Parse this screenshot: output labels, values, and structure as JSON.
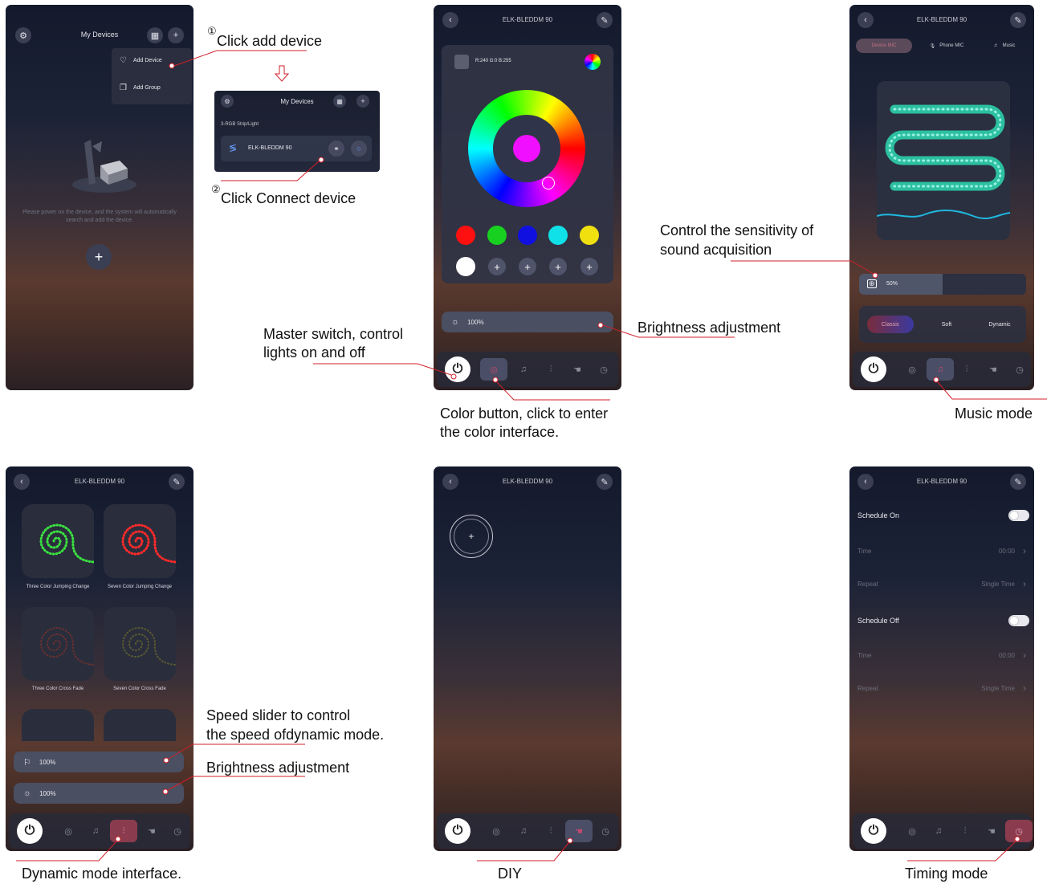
{
  "screen1": {
    "title": "My Devices",
    "menu": {
      "add_device": "Add Device",
      "add_group": "Add Group"
    },
    "hint": "Please power on the device, and the system will automatically search and add the device."
  },
  "popup": {
    "title": "My Devices",
    "section": "3-RGB Strip/Light",
    "device_name": "ELK-BLEDDM 90"
  },
  "screen2": {
    "title": "ELK-BLEDDM 90",
    "rgb_readout": "R:240 G:0 B:255",
    "brightness": "100%",
    "swatches": [
      "#ff1010",
      "#18d020",
      "#1010e0",
      "#10e0e8",
      "#f0e010",
      "#ffffff"
    ],
    "selected_color": "#f010ff"
  },
  "screen3": {
    "title": "ELK-BLEDDM 90",
    "tabs": [
      "Device MIC",
      "Phone MIC",
      "Music"
    ],
    "sensitivity": "50%",
    "sensitivity_fraction": 0.5,
    "modes": [
      "Classic",
      "Soft",
      "Dynamic"
    ]
  },
  "screen4": {
    "title": "ELK-BLEDDM 90",
    "tiles": [
      "Three Color Jumping Change",
      "Seven Color Jumping Change",
      "Three Color Cross Fade",
      "Seven Color Cross Fade"
    ],
    "speed": "100%",
    "brightness": "100%"
  },
  "screen5": {
    "title": "ELK-BLEDDM 90"
  },
  "screen6": {
    "title": "ELK-BLEDDM 90",
    "schedule_on": "Schedule On",
    "schedule_off": "Schedule Off",
    "time_label": "Time",
    "time_value": "00:00",
    "repeat_label": "Repeat",
    "repeat_value": "Single Time"
  },
  "annotations": {
    "step1_num": "①",
    "step1": "Click add device",
    "step2_num": "②",
    "step2": "Click Connect device",
    "master_switch_1": "Master switch, control",
    "master_switch_2": "lights on and off",
    "brightness": "Brightness adjustment",
    "color_btn_1": "Color button, click to enter",
    "color_btn_2": "the color interface.",
    "sensitivity_1": "Control the sensitivity of",
    "sensitivity_2": "sound acquisition",
    "music_mode": "Music mode",
    "speed_1": "Speed slider to control",
    "speed_2": "the speed ofdynamic mode.",
    "brightness2": "Brightness adjustment",
    "dynamic_mode": "Dynamic mode interface.",
    "diy": "DIY",
    "timing": "Timing mode"
  },
  "colors": {
    "annotation_line": "#d0202a",
    "accent": "#8a3c4e"
  }
}
